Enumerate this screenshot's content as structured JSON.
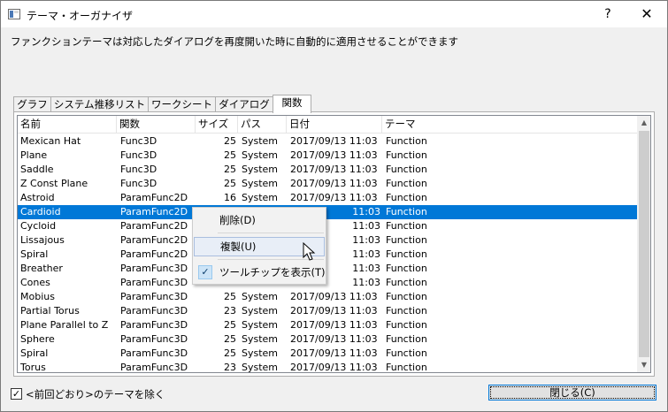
{
  "window": {
    "title": "テーマ・オーガナイザ",
    "help_label": "?",
    "close_label": "✕"
  },
  "description": "ファンクションテーマは対応したダイアログを再度開いた時に自動的に適用させることができます",
  "tabs": [
    {
      "label": "グラフ",
      "active": false
    },
    {
      "label": "システム推移リスト",
      "active": false
    },
    {
      "label": "ワークシート",
      "active": false
    },
    {
      "label": "ダイアログ",
      "active": false
    },
    {
      "label": "関数",
      "active": true
    }
  ],
  "table": {
    "columns": [
      "名前",
      "関数",
      "サイズ",
      "パス",
      "日付",
      "テーマ"
    ],
    "rows": [
      [
        "Mexican Hat",
        "Func3D",
        "25",
        "System",
        "2017/09/13  11:03",
        "Function"
      ],
      [
        "Plane",
        "Func3D",
        "25",
        "System",
        "2017/09/13  11:03",
        "Function"
      ],
      [
        "Saddle",
        "Func3D",
        "25",
        "System",
        "2017/09/13  11:03",
        "Function"
      ],
      [
        "Z Const Plane",
        "Func3D",
        "25",
        "System",
        "2017/09/13  11:03",
        "Function"
      ],
      [
        "Astroid",
        "ParamFunc2D",
        "16",
        "System",
        "2017/09/13  11:03",
        "Function"
      ],
      [
        "Cardioid",
        "ParamFunc2D",
        "",
        "",
        "11:03",
        "Function"
      ],
      [
        "Cycloid",
        "ParamFunc2D",
        "",
        "",
        "11:03",
        "Function"
      ],
      [
        "Lissajous",
        "ParamFunc2D",
        "",
        "",
        "11:03",
        "Function"
      ],
      [
        "Spiral",
        "ParamFunc2D",
        "",
        "",
        "11:03",
        "Function"
      ],
      [
        "Breather",
        "ParamFunc3D",
        "",
        "",
        "11:03",
        "Function"
      ],
      [
        "Cones",
        "ParamFunc3D",
        "",
        "",
        "11:03",
        "Function"
      ],
      [
        "Mobius",
        "ParamFunc3D",
        "25",
        "System",
        "2017/09/13  11:03",
        "Function"
      ],
      [
        "Partial Torus",
        "ParamFunc3D",
        "23",
        "System",
        "2017/09/13  11:03",
        "Function"
      ],
      [
        "Plane Parallel to Z",
        "ParamFunc3D",
        "25",
        "System",
        "2017/09/13  11:03",
        "Function"
      ],
      [
        "Sphere",
        "ParamFunc3D",
        "25",
        "System",
        "2017/09/13  11:03",
        "Function"
      ],
      [
        "Spiral",
        "ParamFunc3D",
        "25",
        "System",
        "2017/09/13  11:03",
        "Function"
      ],
      [
        "Torus",
        "ParamFunc3D",
        "23",
        "System",
        "2017/09/13  11:03",
        "Function"
      ]
    ],
    "selected_row": 5
  },
  "context_menu": {
    "items": [
      {
        "label": "削除(D)",
        "checked": false,
        "hover": false
      },
      {
        "label": "複製(U)",
        "checked": false,
        "hover": true
      },
      {
        "label": "ツールチップを表示(T)",
        "checked": true,
        "hover": false
      }
    ]
  },
  "footer": {
    "exclude_label": "<前回どおり>のテーマを除く",
    "exclude_checked": true,
    "close_button": "閉じる(C)"
  },
  "icons": {
    "check": "✓",
    "scroll_up": "▲",
    "scroll_down": "▼"
  },
  "colors": {
    "selection": "#0078d7",
    "menu_hover": "#e8eef7",
    "button_focus": "#0078d7"
  }
}
